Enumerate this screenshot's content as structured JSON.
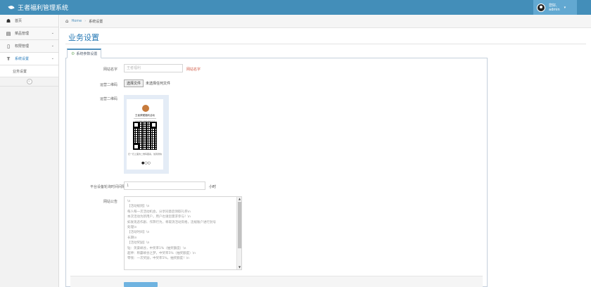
{
  "app": {
    "title": "王者福利管理系统"
  },
  "user": {
    "greeting": "您好,",
    "name": "admin",
    "caret": "▾"
  },
  "sidebar": {
    "items": [
      {
        "label": "首页",
        "icon": "dashboard-icon"
      },
      {
        "label": "菜品管理",
        "icon": "list-icon"
      },
      {
        "label": "权限管理",
        "icon": "file-icon"
      },
      {
        "label": "系统设置",
        "icon": "text-icon"
      }
    ],
    "sub_items": [
      {
        "label": "业务设置"
      }
    ],
    "collapse_glyph": "«",
    "chevron": "⌄"
  },
  "breadcrumb": {
    "home": "Home",
    "separator": "›",
    "current": "系统设置"
  },
  "page": {
    "title": "业务设置"
  },
  "tabs": [
    {
      "label": "系统参数设置",
      "icon": "cog-icon"
    }
  ],
  "form": {
    "site_name": {
      "label": "网站名字",
      "placeholder": "王者福利",
      "help": "网站名字"
    },
    "qr_upload": {
      "label": "运营二维码",
      "button": "选择文件",
      "status": "未选择任何文件"
    },
    "qr_preview": {
      "label": "运营二维码",
      "card_name": "王者荣耀福利活动",
      "card_sub": "长按识别二维码 参加活动",
      "footer": "扫一扫上面的二维码图案，加我微信",
      "logo": "●○○"
    },
    "interval": {
      "label": "平台设备轮询时间间隔",
      "value": "1",
      "suffix": "小时"
    },
    "notice": {
      "label": "网站公告",
      "lines": [
        "\\n",
        "【活动规则】\\n",
        "每人每一次活动机会，分享同意后领取礼券\\n",
        "本次活动为新用户，用户也请您需求参与！\\n",
        "如发现恶作剧、作弊行为，将取消活动资格，违规账户进行封号",
        "处理\\n",
        "【活动时间】\\n",
        "长期\\n",
        "【活动奖励】\\n",
        "钻：英豪峡谷，中奖率1%（抽奖额度）\\n",
        "超神：称霸峡谷之梦，中奖率5%（抽奖额度）\\n",
        "零钱：一次奖励，中奖率5%，抽奖额度！\\n"
      ]
    }
  },
  "colors": {
    "accent": "#438eb9",
    "link": "#2679b5",
    "danger": "#d15b47",
    "button": "#6fb3e0"
  }
}
